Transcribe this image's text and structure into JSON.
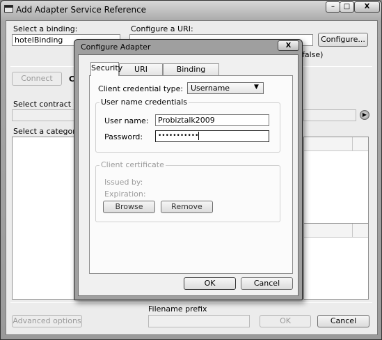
{
  "outer": {
    "title": "Add Adapter Service Reference",
    "controls": {
      "minimize": "–",
      "maximize": "□",
      "close": "X"
    },
    "binding_label": "Select a binding:",
    "binding_value": "hotelBinding",
    "uri_label": "Configure a URI:",
    "uri_value": "",
    "configure_button": "Configure...",
    "connect_button": "Connect",
    "partial_status": "Co",
    "contract_label": "Select contract type:",
    "category_label": "Select a category:",
    "partial_uri_text": "false)",
    "filename_prefix_label": "Filename prefix",
    "advanced_button": "Advanced options",
    "ok_button": "OK",
    "cancel_button": "Cancel"
  },
  "dialog": {
    "title": "Configure Adapter",
    "close": "X",
    "tabs": [
      {
        "label": "Security",
        "active": true
      },
      {
        "label": "URI Properties",
        "active": false
      },
      {
        "label": "Binding Properties",
        "active": false
      }
    ],
    "credential_type_label": "Client credential type:",
    "credential_type_value": "Username",
    "username_group_label": "User name credentials",
    "username_label": "User name:",
    "username_value": "Probiztalk2009",
    "password_label": "Password:",
    "password_value": "•••••••••••",
    "client_cert_group_label": "Client certificate",
    "issued_by_label": "Issued by:",
    "expiration_label": "Expiration:",
    "browse_button": "Browse",
    "remove_button": "Remove",
    "ok_button": "OK",
    "cancel_button": "Cancel"
  }
}
